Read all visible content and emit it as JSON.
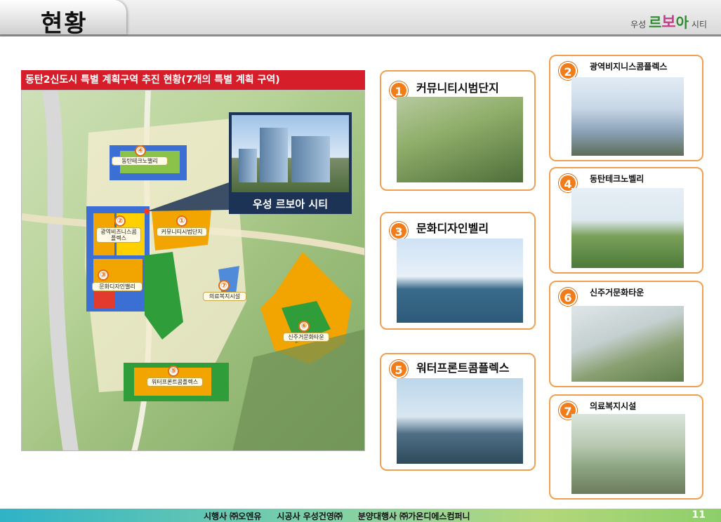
{
  "header": {
    "title": "현황",
    "brand_small": "우성",
    "brand_r": "르",
    "brand_bo": "보",
    "brand_a": "아",
    "brand_city": "시티"
  },
  "map": {
    "title": "동탄2신도시 특별 계획구역 추진 현황(7개의 특별 계획 구역)",
    "callout_label": "우성 르보아 시티",
    "zones": [
      {
        "num": "④",
        "label": "동탄테크노밸리"
      },
      {
        "num": "②",
        "label": "광역비즈니스콤플렉스"
      },
      {
        "num": "①",
        "label": "커뮤니티시범단지"
      },
      {
        "num": "③",
        "label": "문화디자인밸리"
      },
      {
        "num": "⑦",
        "label": "의료복지시설"
      },
      {
        "num": "⑥",
        "label": "신주거문화타운"
      },
      {
        "num": "⑤",
        "label": "워터프론트콤플렉스"
      }
    ]
  },
  "cards": [
    {
      "num": "1",
      "title": "커뮤니티시범단지"
    },
    {
      "num": "2",
      "title": "광역비지니스콤플렉스"
    },
    {
      "num": "3",
      "title": "문화디자인벨리"
    },
    {
      "num": "4",
      "title": "동탄테크노벨리"
    },
    {
      "num": "5",
      "title": "워터프론트콤플렉스"
    },
    {
      "num": "6",
      "title": "신주거문화타운"
    },
    {
      "num": "7",
      "title": "의료복지시설"
    }
  ],
  "footer": {
    "executor": "시행사 ㈜오엔유",
    "builder": "시공사 우성건영㈜",
    "agency": "분양대행사 ㈜가온디에스컴퍼니",
    "page": "11"
  },
  "colors": {
    "accent_red": "#d61e2a",
    "accent_orange": "#f07d1a",
    "card_border": "#f0a050"
  }
}
